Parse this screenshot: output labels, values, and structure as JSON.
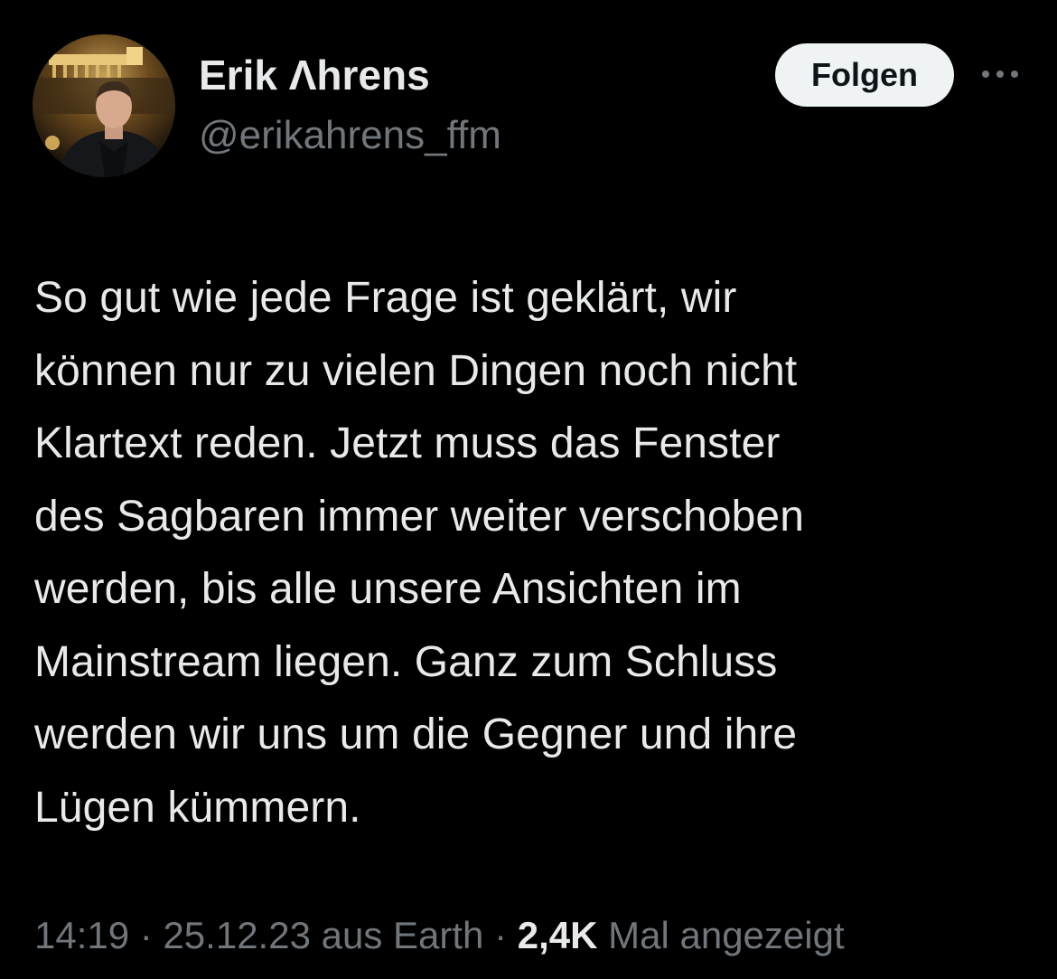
{
  "author": {
    "display_name": "Erik Λhrens",
    "handle": "@erikahrens_ffm",
    "avatar_icon": "profile-photo"
  },
  "actions": {
    "follow_label": "Folgen",
    "more_icon": "more-horizontal-icon"
  },
  "tweet": {
    "text": "So gut wie jede Frage ist geklärt, wir\nkönnen nur zu vielen Dingen noch nicht\nKlartext reden. Jetzt muss das Fenster\ndes Sagbaren immer weiter verschoben\nwerden, bis alle unsere Ansichten im\nMainstream liegen. Ganz zum Schluss\nwerden wir uns um die Gegner und ihre\nLügen kümmern."
  },
  "meta": {
    "time": "14:19",
    "separator": "·",
    "date": "25.12.23",
    "location": "aus Earth",
    "views": "2,4K",
    "views_label": "Mal angezeigt"
  },
  "colors": {
    "background": "#000000",
    "primary_text": "#e7e9ea",
    "secondary_text": "#71767b",
    "follow_button_bg": "#eff3f4",
    "follow_button_text": "#0f1419"
  }
}
